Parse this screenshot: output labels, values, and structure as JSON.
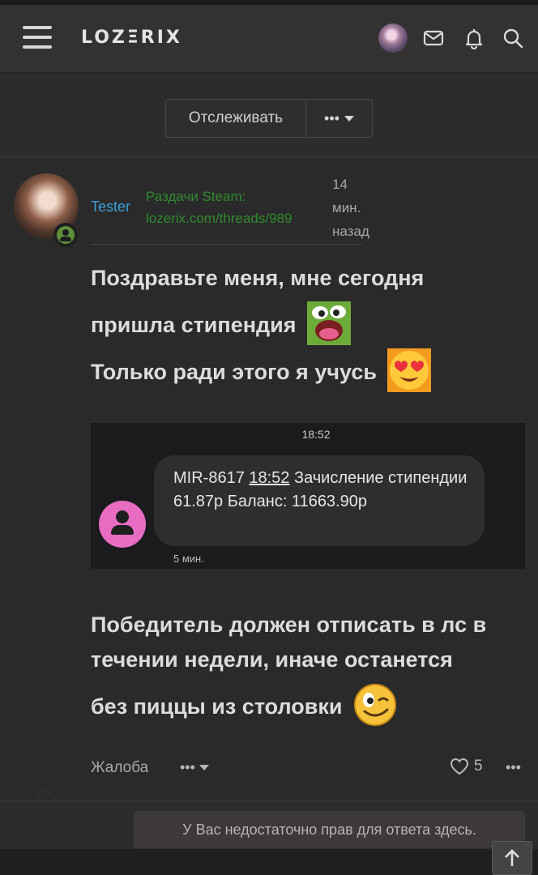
{
  "header": {
    "logo": "LOZΞRIX",
    "icons": [
      "menu-icon",
      "avatar",
      "mail-icon",
      "bell-icon",
      "search-icon"
    ]
  },
  "thread_actions": {
    "follow_label": "Отслеживать",
    "more_label": "•••"
  },
  "post": {
    "username": "Tester",
    "user_status": "Раздачи Steam:\nlozerix.com/threads/989",
    "time_line1": "14",
    "time_line2": "мин.",
    "time_line3": "назад",
    "text_line1": "Поздравьте меня, мне сегодня",
    "text_line2": "пришла стипендия",
    "text_line3": "Только ради этого я учусь",
    "screenshot": {
      "time": "18:52",
      "sms_part1": "MIR-8617 ",
      "sms_underlined": "18:52",
      "sms_part2": " Зачисление стипендии 61.87р Баланс: 11663.90р",
      "footer": "5 мин."
    },
    "text_line4": "Победитель должен отписать в лс в",
    "text_line5": "течении недели, иначе останется",
    "text_line6": "без пиццы из столовки",
    "report_label": "Жалоба",
    "more_label": "•••",
    "like_count": "5",
    "post_more_label": "•••"
  },
  "notice": "У Вас недостаточно прав для ответа здесь.",
  "colors": {
    "username": "#3aa0d9",
    "status": "#2f8a2f",
    "background": "#2a2a2a"
  }
}
